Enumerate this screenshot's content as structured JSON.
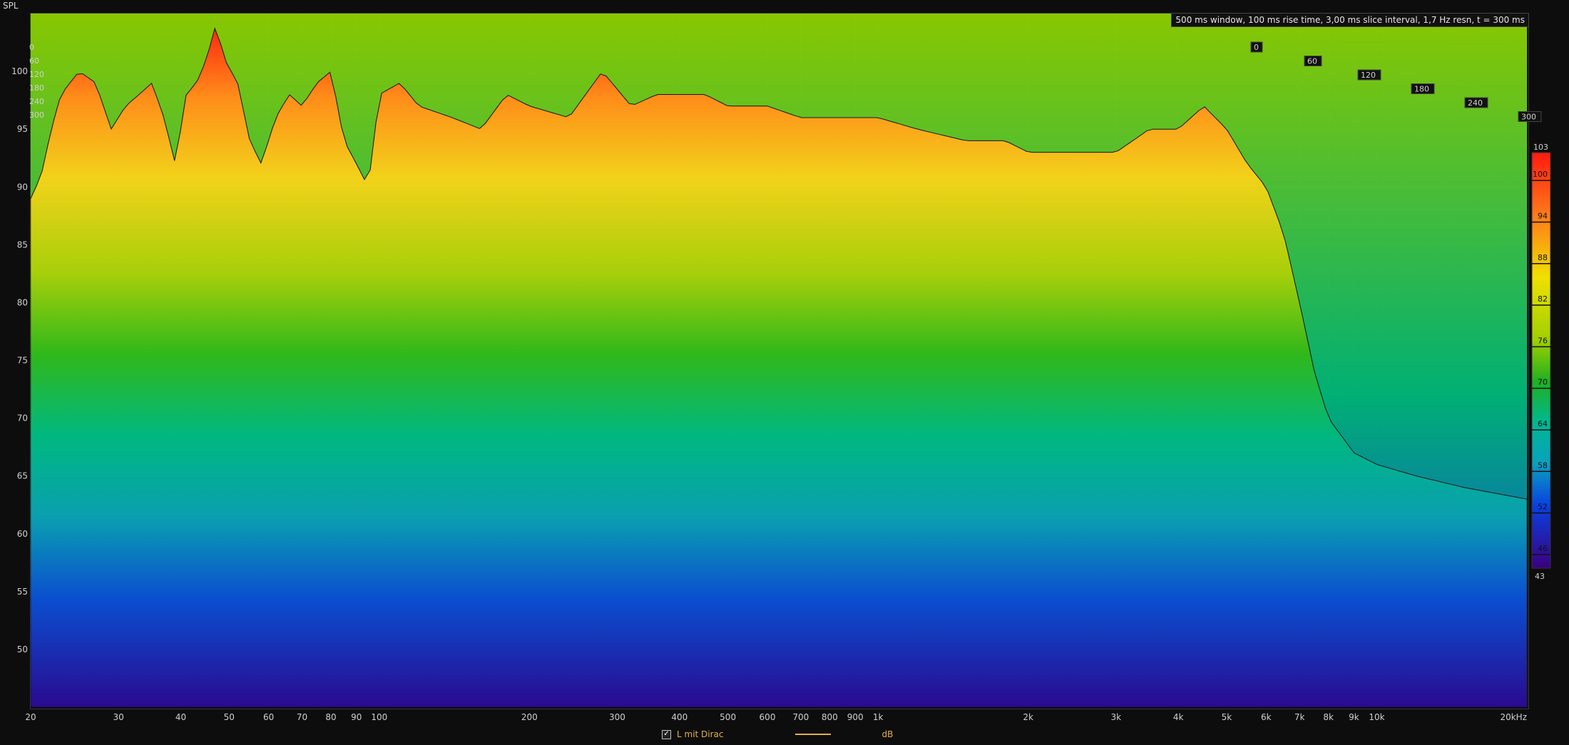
{
  "window": {
    "y_axis_title": "SPL"
  },
  "info_text": "500 ms window, 100 ms rise time, 3,00 ms slice interval, 1,7 Hz resn, t = 300 ms",
  "legend": {
    "series_label": "L mit Dirac",
    "unit": "dB",
    "checked": "✓",
    "color": "#e3b04b"
  },
  "chart_data": {
    "type": "waterfall",
    "xscale": "log",
    "xlim": [
      20,
      20000
    ],
    "ylim": [
      45,
      105
    ],
    "x_ticks": [
      {
        "v": 20,
        "label": "20"
      },
      {
        "v": 30,
        "label": "30"
      },
      {
        "v": 40,
        "label": "40"
      },
      {
        "v": 50,
        "label": "50"
      },
      {
        "v": 60,
        "label": "60"
      },
      {
        "v": 70,
        "label": "70"
      },
      {
        "v": 80,
        "label": "80"
      },
      {
        "v": 90,
        "label": "90"
      },
      {
        "v": 100,
        "label": "100"
      },
      {
        "v": 200,
        "label": "200"
      },
      {
        "v": 300,
        "label": "300"
      },
      {
        "v": 400,
        "label": "400"
      },
      {
        "v": 500,
        "label": "500"
      },
      {
        "v": 600,
        "label": "600"
      },
      {
        "v": 700,
        "label": "700"
      },
      {
        "v": 800,
        "label": "800"
      },
      {
        "v": 900,
        "label": "900"
      },
      {
        "v": 1000,
        "label": "1k"
      },
      {
        "v": 2000,
        "label": "2k"
      },
      {
        "v": 3000,
        "label": "3k"
      },
      {
        "v": 4000,
        "label": "4k"
      },
      {
        "v": 5000,
        "label": "5k"
      },
      {
        "v": 6000,
        "label": "6k"
      },
      {
        "v": 7000,
        "label": "7k"
      },
      {
        "v": 8000,
        "label": "8k"
      },
      {
        "v": 9000,
        "label": "9k"
      },
      {
        "v": 10000,
        "label": "10k"
      },
      {
        "v": 20000,
        "label": "20kHz"
      }
    ],
    "y_ticks": [
      50,
      55,
      60,
      65,
      70,
      75,
      80,
      85,
      90,
      95,
      100
    ],
    "time_axis_labels_right": [
      "0",
      "60",
      "120",
      "180",
      "240",
      "300"
    ],
    "time_axis_labels_left": [
      "0",
      "60",
      "120",
      "180",
      "240",
      "300"
    ],
    "time_range_ms": [
      0,
      300
    ],
    "colorbar": {
      "min": 43,
      "max": 103,
      "ticks": [
        100,
        94,
        88,
        82,
        76,
        70,
        64,
        58,
        52,
        46
      ]
    },
    "front_slice": {
      "x": [
        20,
        21,
        22,
        23,
        25,
        27,
        29,
        31,
        33,
        35,
        37,
        39,
        41,
        43,
        45,
        47,
        49,
        52,
        55,
        58,
        62,
        66,
        70,
        75,
        80,
        85,
        90,
        95,
        100,
        110,
        120,
        140,
        160,
        180,
        200,
        240,
        280,
        320,
        360,
        400,
        450,
        500,
        600,
        700,
        800,
        900,
        1000,
        1200,
        1500,
        1800,
        2000,
        2500,
        3000,
        3500,
        4000,
        4500,
        5000,
        5500,
        6000,
        6500,
        7000,
        7500,
        8000,
        9000,
        10000,
        12000,
        15000,
        20000
      ],
      "y": [
        89,
        91,
        95,
        98,
        100,
        99,
        95,
        97,
        98,
        99,
        96,
        92,
        98,
        99,
        101,
        104,
        101,
        99,
        94,
        92,
        96,
        98,
        97,
        99,
        100,
        94,
        92,
        90,
        98,
        99,
        97,
        96,
        95,
        98,
        97,
        96,
        100,
        97,
        98,
        98,
        98,
        97,
        97,
        96,
        96,
        96,
        96,
        95,
        94,
        94,
        93,
        93,
        93,
        95,
        95,
        97,
        95,
        92,
        90,
        86,
        80,
        74,
        70,
        67,
        66,
        65,
        64,
        63
      ]
    }
  }
}
